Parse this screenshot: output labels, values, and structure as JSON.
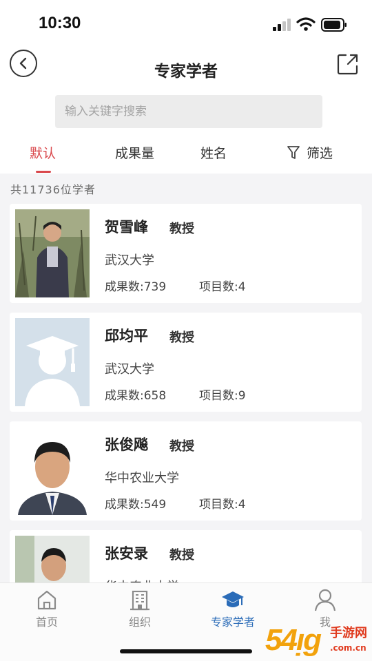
{
  "status_bar": {
    "time": "10:30"
  },
  "header": {
    "title": "专家学者"
  },
  "search": {
    "placeholder": "输入关键字搜索"
  },
  "filter_tabs": [
    {
      "label": "默认",
      "active": true
    },
    {
      "label": "成果量",
      "active": false
    },
    {
      "label": "姓名",
      "active": false
    },
    {
      "label": "筛选",
      "icon": "funnel-icon",
      "active": false
    }
  ],
  "summary": {
    "count_text": "共11736位学者"
  },
  "scholars": [
    {
      "name": "贺雪峰",
      "title": "教授",
      "org": "武汉大学",
      "results": "成果数:739",
      "projects": "项目数:4",
      "avatar": "photo"
    },
    {
      "name": "邱均平",
      "title": "教授",
      "org": "武汉大学",
      "results": "成果数:658",
      "projects": "项目数:9",
      "avatar": "graduate-placeholder-icon"
    },
    {
      "name": "张俊飚",
      "title": "教授",
      "org": "华中农业大学",
      "results": "成果数:549",
      "projects": "项目数:4",
      "avatar": "photo"
    },
    {
      "name": "张安录",
      "title": "教授",
      "org": "华中农业大学",
      "avatar": "photo"
    }
  ],
  "bottom_nav": [
    {
      "label": "首页",
      "icon": "home-icon",
      "active": false
    },
    {
      "label": "组织",
      "icon": "building-icon",
      "active": false
    },
    {
      "label": "专家学者",
      "icon": "graduation-cap-icon",
      "active": true
    },
    {
      "label": "我",
      "icon": "person-icon",
      "active": false
    }
  ],
  "watermark": {
    "logo": "54ᴉg",
    "cn": "手游网",
    "url": ".com.cn"
  },
  "colors": {
    "accent_red": "#d9474b",
    "active_blue": "#2b6cb8",
    "background": "#f4f4f6"
  }
}
